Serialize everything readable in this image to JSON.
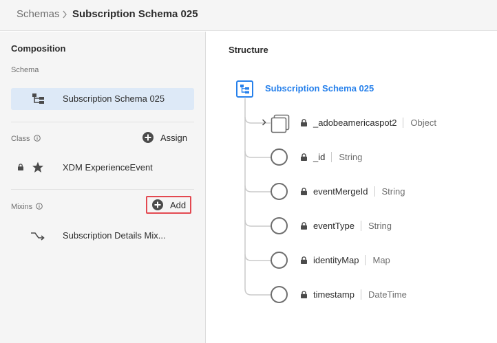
{
  "breadcrumb": {
    "root": "Schemas",
    "current": "Subscription Schema 025"
  },
  "composition": {
    "title": "Composition",
    "schema_label": "Schema",
    "schema_name": "Subscription Schema 025",
    "class_label": "Class",
    "assign_label": "Assign",
    "class_name": "XDM ExperienceEvent",
    "mixins_label": "Mixins",
    "add_label": "Add",
    "mixin_name": "Subscription Details Mix..."
  },
  "structure": {
    "title": "Structure",
    "root_name": "Subscription Schema 025",
    "fields": [
      {
        "name": "_adobeamericaspot2",
        "type": "Object",
        "expandable": true
      },
      {
        "name": "_id",
        "type": "String",
        "expandable": false
      },
      {
        "name": "eventMergeId",
        "type": "String",
        "expandable": false
      },
      {
        "name": "eventType",
        "type": "String",
        "expandable": false
      },
      {
        "name": "identityMap",
        "type": "Map",
        "expandable": false
      },
      {
        "name": "timestamp",
        "type": "DateTime",
        "expandable": false
      }
    ]
  },
  "colors": {
    "accent": "#2680eb",
    "highlight": "#dde9f7",
    "add_border": "#e34850"
  },
  "icons": [
    "chevron-right-icon",
    "info-icon",
    "schema-tree-icon",
    "plus-circle-icon",
    "lock-icon",
    "star-icon",
    "mixin-icon",
    "object-icon"
  ]
}
